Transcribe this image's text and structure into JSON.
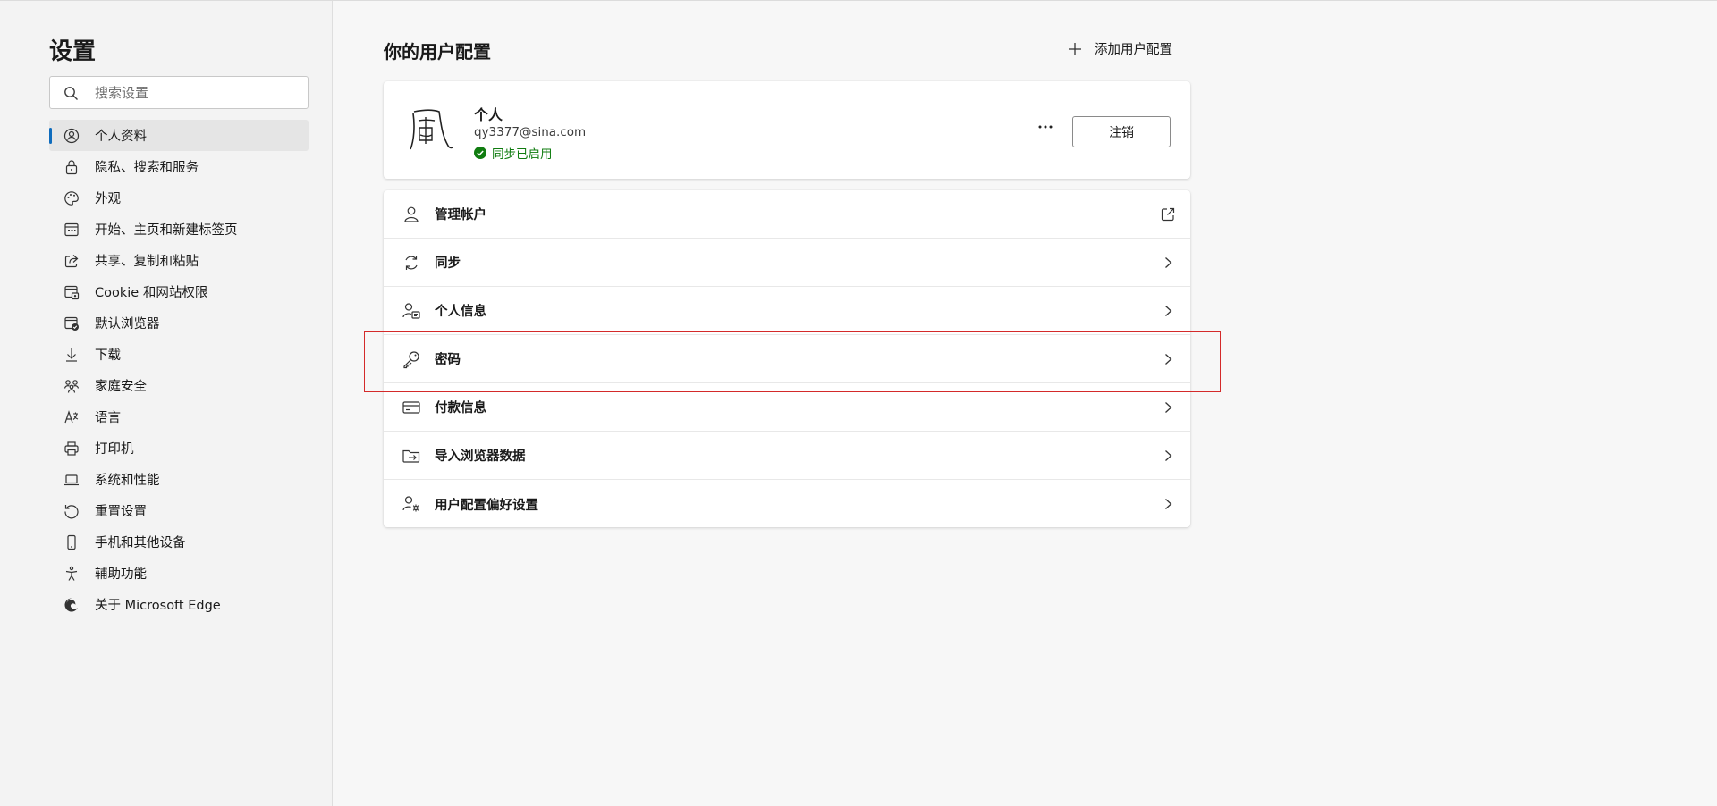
{
  "sidebar": {
    "title": "设置",
    "search_placeholder": "搜索设置",
    "items": [
      {
        "label": "个人资料",
        "icon": "profile-icon",
        "active": true
      },
      {
        "label": "隐私、搜索和服务",
        "icon": "lock-icon"
      },
      {
        "label": "外观",
        "icon": "palette-icon"
      },
      {
        "label": "开始、主页和新建标签页",
        "icon": "home-tabs-icon"
      },
      {
        "label": "共享、复制和粘贴",
        "icon": "share-icon"
      },
      {
        "label": "Cookie 和网站权限",
        "icon": "site-permissions-icon"
      },
      {
        "label": "默认浏览器",
        "icon": "default-browser-icon"
      },
      {
        "label": "下载",
        "icon": "download-icon"
      },
      {
        "label": "家庭安全",
        "icon": "family-icon"
      },
      {
        "label": "语言",
        "icon": "language-icon"
      },
      {
        "label": "打印机",
        "icon": "printer-icon"
      },
      {
        "label": "系统和性能",
        "icon": "laptop-icon"
      },
      {
        "label": "重置设置",
        "icon": "reset-icon"
      },
      {
        "label": "手机和其他设备",
        "icon": "phone-icon"
      },
      {
        "label": "辅助功能",
        "icon": "accessibility-icon"
      },
      {
        "label": "关于 Microsoft Edge",
        "icon": "edge-icon"
      }
    ]
  },
  "main": {
    "title": "你的用户配置",
    "add_profile_label": "添加用户配置",
    "profile": {
      "name": "个人",
      "email": "qy3377@sina.com",
      "sync_status": "同步已启用",
      "more_label": "···",
      "signout_label": "注销",
      "avatar_char": "風"
    },
    "rows": [
      {
        "label": "管理帐户",
        "icon": "person-icon",
        "action": "external-link-icon"
      },
      {
        "label": "同步",
        "icon": "sync-icon",
        "action": "chevron-right-icon"
      },
      {
        "label": "个人信息",
        "icon": "personal-info-icon",
        "action": "chevron-right-icon"
      },
      {
        "label": "密码",
        "icon": "key-icon",
        "action": "chevron-right-icon"
      },
      {
        "label": "付款信息",
        "icon": "credit-card-icon",
        "action": "chevron-right-icon"
      },
      {
        "label": "导入浏览器数据",
        "icon": "import-icon",
        "action": "chevron-right-icon"
      },
      {
        "label": "用户配置偏好设置",
        "icon": "profile-preferences-icon",
        "action": "chevron-right-icon"
      }
    ]
  },
  "colors": {
    "accent": "#0f6cbd",
    "sync_green": "#107c10",
    "highlight_red": "#d42a2a"
  }
}
